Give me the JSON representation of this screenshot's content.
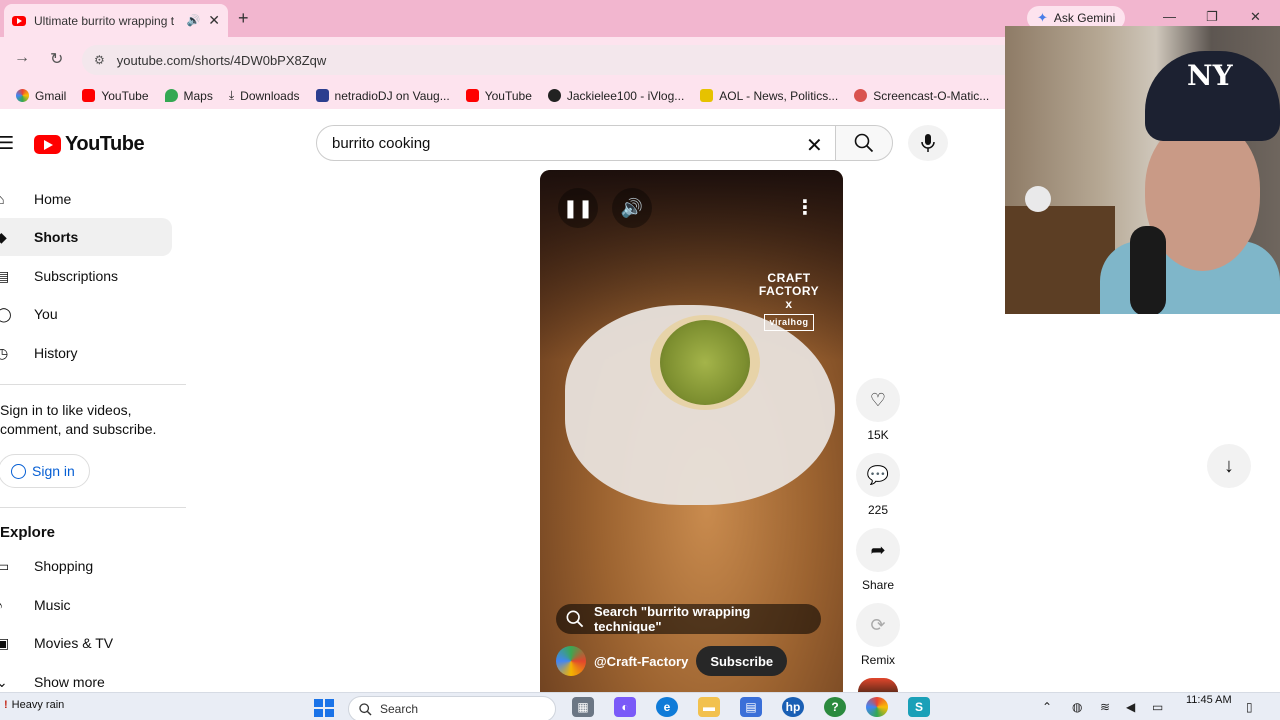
{
  "browser": {
    "tab_title": "Ultimate burrito wrapping t",
    "url": "youtube.com/shorts/4DW0bPX8Zqw",
    "gemini_label": "Ask Gemini",
    "bookmarks": [
      "Gmail",
      "YouTube",
      "Maps",
      "Downloads",
      "netradioDJ on Vaug...",
      "YouTube",
      "Jackielee100 - iVlog...",
      "AOL - News, Politics...",
      "Screencast-O-Matic..."
    ]
  },
  "youtube": {
    "logo_text": "YouTube",
    "search_value": "burrito cooking",
    "sidebar": {
      "items": [
        "Home",
        "Shorts",
        "Subscriptions",
        "You",
        "History"
      ],
      "signin_text": "Sign in to like videos, comment, and subscribe.",
      "signin_label": "Sign in",
      "explore_heading": "Explore",
      "explore_items": [
        "Shopping",
        "Music",
        "Movies & TV",
        "Show more"
      ]
    },
    "short": {
      "watermark_line1": "CRAFT",
      "watermark_line2": "FACTORY",
      "watermark_line3": "x",
      "watermark_tag": "viralhog",
      "search_suggestion": "Search \"burrito wrapping technique\"",
      "channel": "@Craft-Factory",
      "subscribe_label": "Subscribe"
    },
    "actions": {
      "likes": "15K",
      "comments": "225",
      "share_label": "Share",
      "remix_label": "Remix"
    }
  },
  "taskbar": {
    "weather": "Heavy rain",
    "search_placeholder": "Search",
    "time": "11:45 AM"
  },
  "colors": {
    "tabstrip": "#f2b6cf",
    "youtube_red": "#ff0000",
    "link_blue": "#065fd4"
  }
}
